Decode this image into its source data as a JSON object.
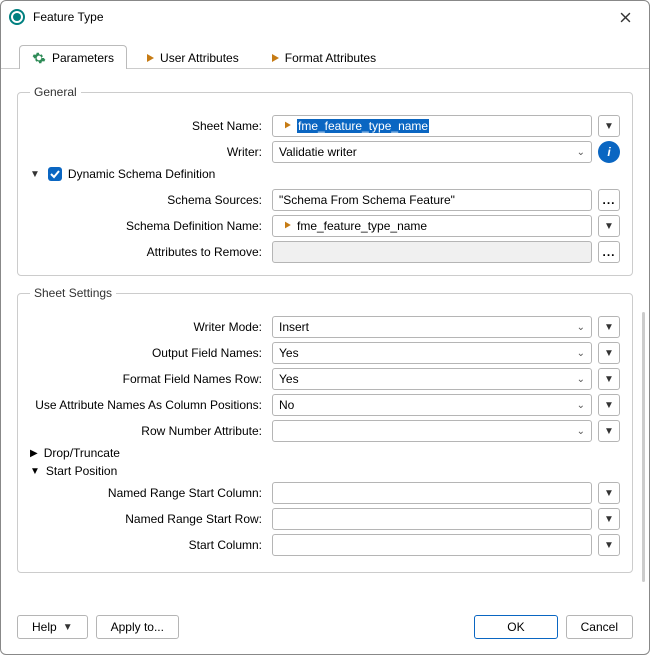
{
  "window": {
    "title": "Feature Type"
  },
  "tabs": {
    "parameters": "Parameters",
    "user_attributes": "User Attributes",
    "format_attributes": "Format Attributes"
  },
  "general": {
    "legend": "General",
    "sheet_name_label": "Sheet Name:",
    "sheet_name_value": "fme_feature_type_name",
    "writer_label": "Writer:",
    "writer_value": "Validatie writer",
    "dynamic_label": "Dynamic Schema Definition",
    "schema_sources_label": "Schema Sources:",
    "schema_sources_value": "\"Schema From Schema Feature\"",
    "schema_def_name_label": "Schema Definition Name:",
    "schema_def_name_value": "fme_feature_type_name",
    "attrs_remove_label": "Attributes to Remove:"
  },
  "sheet": {
    "legend": "Sheet Settings",
    "writer_mode_label": "Writer Mode:",
    "writer_mode_value": "Insert",
    "output_field_names_label": "Output Field Names:",
    "output_field_names_value": "Yes",
    "format_field_names_row_label": "Format Field Names Row:",
    "format_field_names_row_value": "Yes",
    "use_attr_cols_label": "Use Attribute Names As Column Positions:",
    "use_attr_cols_value": "No",
    "row_number_attr_label": "Row Number Attribute:",
    "drop_truncate_label": "Drop/Truncate",
    "start_position_label": "Start Position",
    "named_range_start_col_label": "Named Range Start Column:",
    "named_range_start_row_label": "Named Range Start Row:",
    "start_column_label": "Start Column:"
  },
  "footer": {
    "help": "Help",
    "apply_to": "Apply to...",
    "ok": "OK",
    "cancel": "Cancel"
  }
}
